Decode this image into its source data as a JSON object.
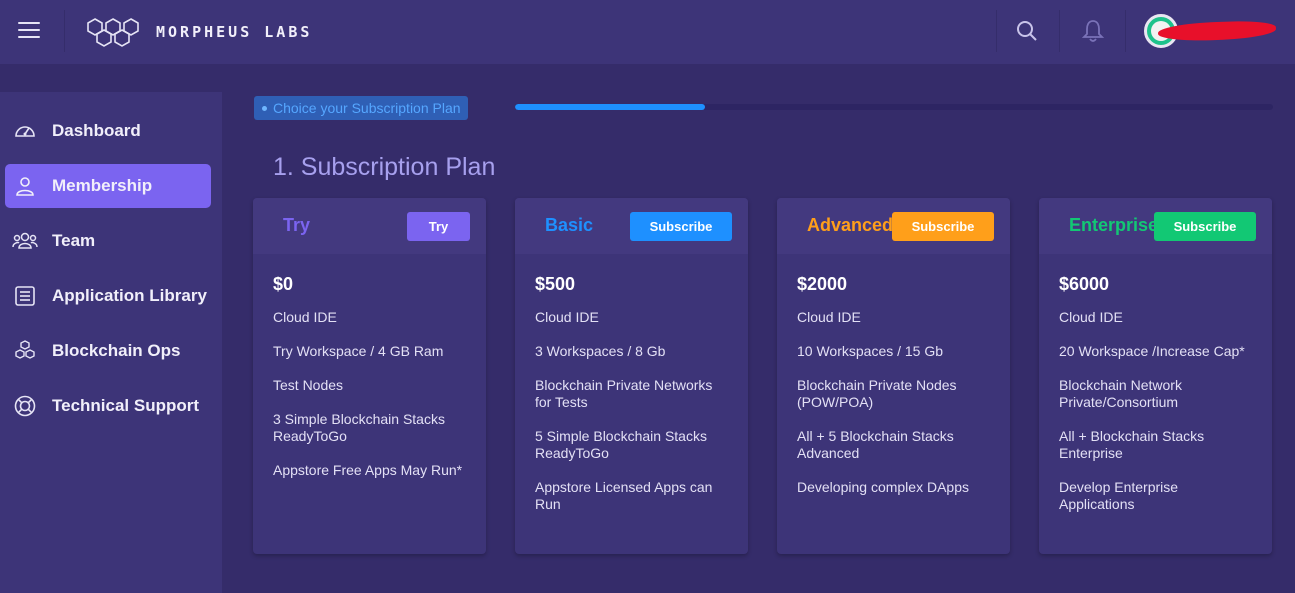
{
  "header": {
    "brand": "MORPHEUS LABS",
    "icons": [
      "menu-icon",
      "search-icon",
      "bell-icon"
    ]
  },
  "sidebar": {
    "items": [
      {
        "label": "Dashboard",
        "icon": "speedometer-icon"
      },
      {
        "label": "Membership",
        "icon": "user-icon"
      },
      {
        "label": "Team",
        "icon": "team-icon"
      },
      {
        "label": "Application Library",
        "icon": "list-icon"
      },
      {
        "label": "Blockchain Ops",
        "icon": "cubes-icon"
      },
      {
        "label": "Technical Support",
        "icon": "lifebuoy-icon"
      }
    ]
  },
  "wizard": {
    "step_label": "Choice your Subscription Plan",
    "progress": 0.25
  },
  "main": {
    "title": "1. Subscription Plan"
  },
  "plans": [
    {
      "name": "Try",
      "name_color": "#7b64f0",
      "button": "Try",
      "button_color": "#7b64f0",
      "price": "$0",
      "features": [
        "Cloud IDE",
        "Try Workspace / 4 GB Ram",
        "Test Nodes",
        "3 Simple Blockchain Stacks ReadyToGo",
        "Appstore Free Apps May Run*"
      ]
    },
    {
      "name": "Basic",
      "name_color": "#1e90ff",
      "button": "Subscribe",
      "button_color": "#1e90ff",
      "price": "$500",
      "features": [
        "Cloud IDE",
        "3 Workspaces / 8 Gb",
        "Blockchain Private Networks for Tests",
        "5 Simple Blockchain Stacks ReadyToGo",
        "Appstore Licensed Apps can Run"
      ]
    },
    {
      "name": "Advanced",
      "name_color": "#ff9f1a",
      "button": "Subscribe",
      "button_color": "#ff9f1a",
      "price": "$2000",
      "features": [
        "Cloud IDE",
        "10 Workspaces / 15 Gb",
        "Blockchain Private Nodes (POW/POA)",
        "All + 5 Blockchain Stacks Advanced",
        "Developing complex DApps"
      ]
    },
    {
      "name": "Enterprise",
      "name_color": "#12c874",
      "button": "Subscribe",
      "button_color": "#12c874",
      "price": "$6000",
      "features": [
        "Cloud IDE",
        "20 Workspace /Increase Cap*",
        "Blockchain Network Private/Consortium",
        "All + Blockchain Stacks Enterprise",
        "Develop Enterprise Applications"
      ]
    }
  ]
}
